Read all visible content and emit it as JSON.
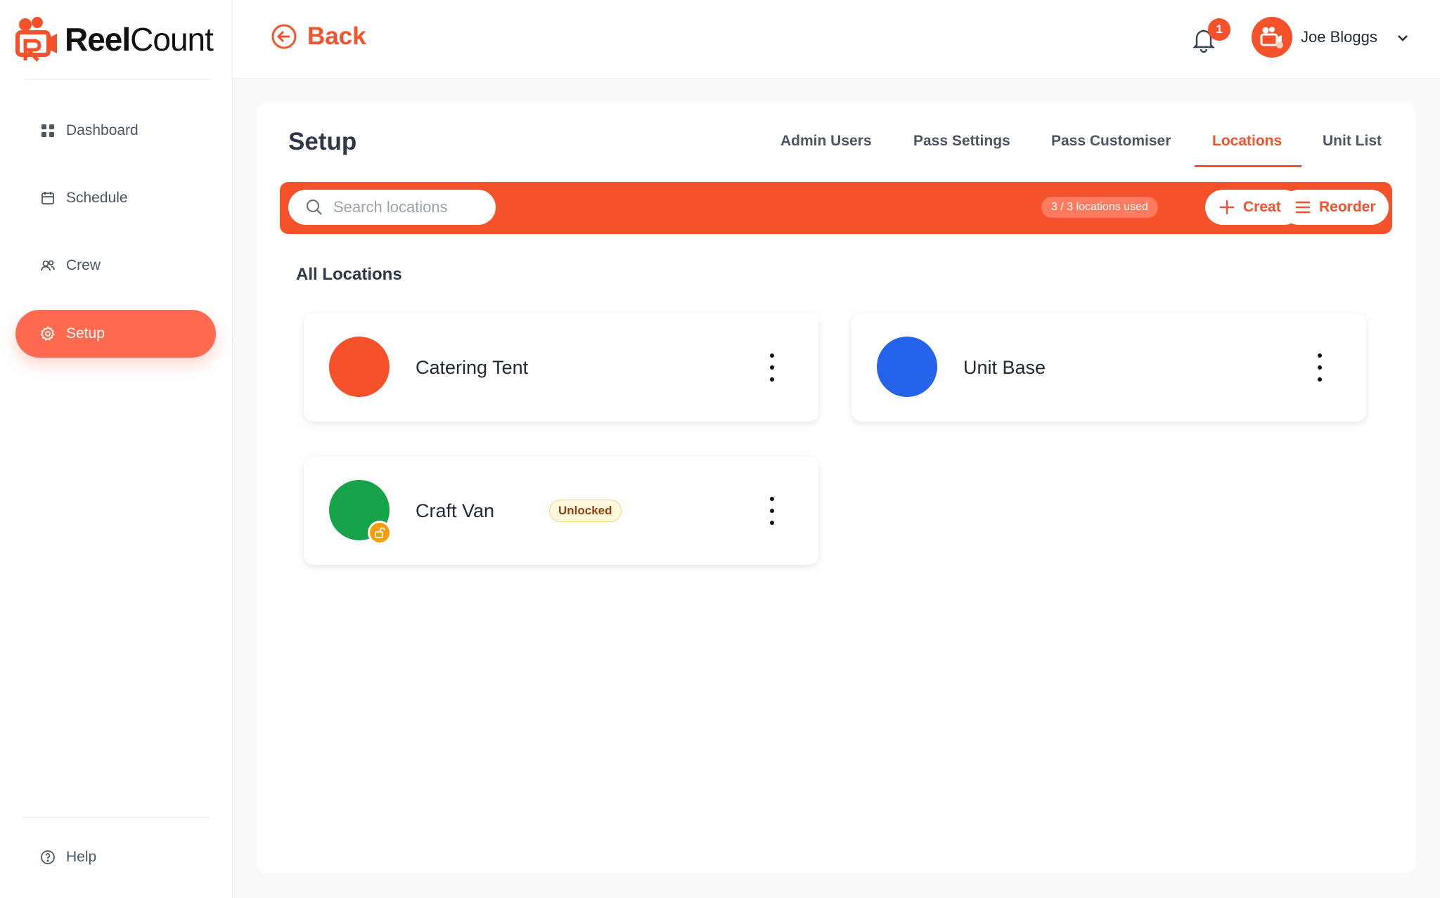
{
  "app": {
    "logo_bold": "Reel",
    "logo_light": "Count"
  },
  "sidebar": {
    "items": [
      {
        "label": "Dashboard",
        "icon": "grid-icon",
        "active": false
      },
      {
        "label": "Schedule",
        "icon": "calendar-icon",
        "active": false
      },
      {
        "label": "Crew",
        "icon": "users-icon",
        "active": false
      },
      {
        "label": "Setup",
        "icon": "gear-icon",
        "active": true
      }
    ],
    "help_label": "Help"
  },
  "header": {
    "back_label": "Back",
    "notification_count": "1",
    "user_name": "Joe Bloggs"
  },
  "page": {
    "title": "Setup",
    "tabs": [
      {
        "label": "Admin Users",
        "active": false
      },
      {
        "label": "Pass Settings",
        "active": false
      },
      {
        "label": "Pass Customiser",
        "active": false
      },
      {
        "label": "Locations",
        "active": true
      },
      {
        "label": "Unit List",
        "active": false
      }
    ],
    "search_placeholder": "Search locations",
    "usage_text": "3 / 3 locations used",
    "create_label": "Create",
    "reorder_label": "Reorder",
    "section_title": "All Locations",
    "locations": [
      {
        "name": "Catering Tent",
        "color": "#f5512b",
        "badge": ""
      },
      {
        "name": "Unit Base",
        "color": "#2563eb",
        "badge": ""
      },
      {
        "name": "Craft Van",
        "color": "#16a34a",
        "badge": "Unlocked"
      }
    ]
  },
  "colors": {
    "accent": "#f5512b",
    "sidebar_active": "#ff6a50",
    "unlocked_badge": "#f59e0b"
  }
}
